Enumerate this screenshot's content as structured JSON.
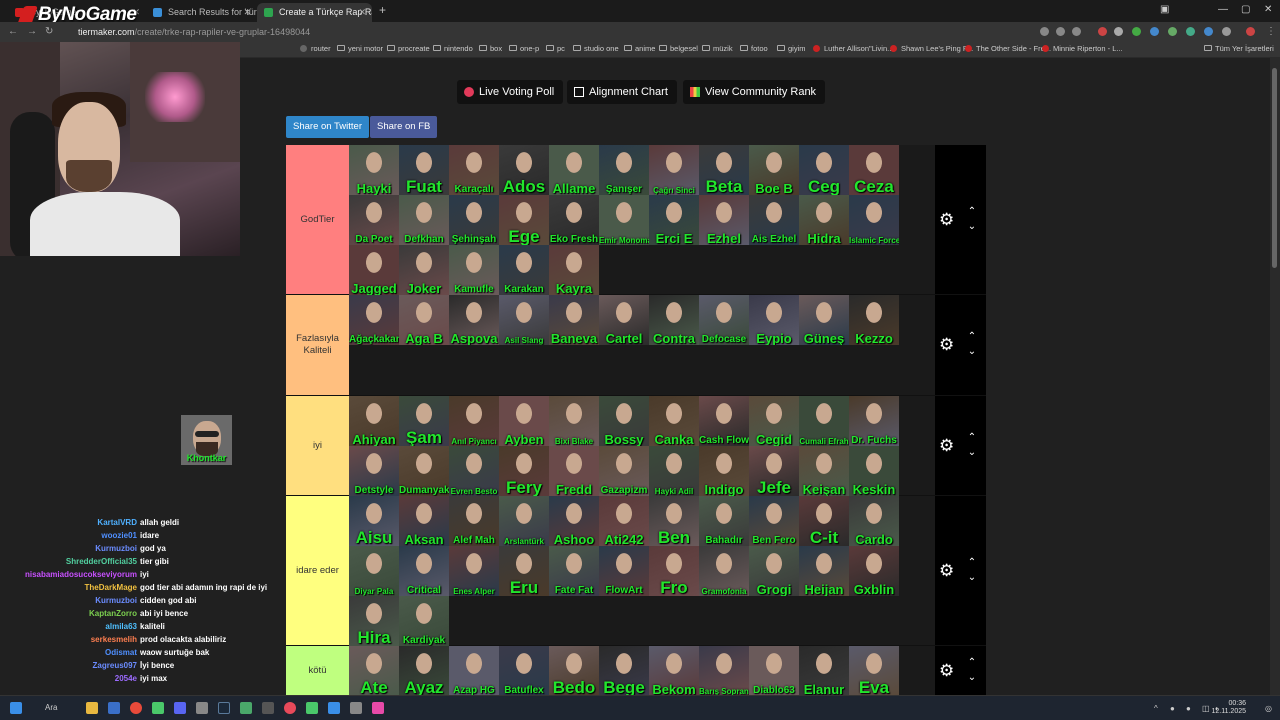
{
  "browser": {
    "tabs": [
      {
        "label": "ByNoGame",
        "active": false
      },
      {
        "label": "Search Results for 'türkçe rap'",
        "active": false
      },
      {
        "label": "Create a Türkçe Rap Rapçiler ve",
        "active": true
      }
    ],
    "url_host": "tiermaker.com",
    "url_path": "/create/trke-rap-rapiler-ve-gruplar-16498044",
    "bookmarks": [
      "router",
      "yeni motor",
      "procreate",
      "nintendo",
      "box",
      "one-p",
      "pc",
      "studio one",
      "anime",
      "belgesel",
      "müzik",
      "fotoo",
      "giyim",
      "Luther Allison\"Livin...",
      "Shawn Lee's Ping P...",
      "The Other Side - Fre...",
      "Minnie Riperton - L...",
      "Tüm Yer İşaretleri"
    ]
  },
  "overlay": {
    "logo": "ByNoGame",
    "small_cam_name": "Khontkar"
  },
  "toolbar": {
    "live_voting": "Live Voting Poll",
    "alignment_chart": "Alignment Chart",
    "community_rank": "View Community Rank",
    "share_twitter": "Share on Twitter",
    "share_fb": "Share on FB"
  },
  "tiers": [
    {
      "label": "GodTier",
      "color": "#ff7f7f",
      "items": [
        "Hayki",
        "Fuat",
        "Karaçalı",
        "Ados",
        "Allame",
        "Şanışer",
        "Çağrı Sinci",
        "Beta",
        "Boe B",
        "Ceg",
        "Ceza",
        "Da Poet",
        "Defkhan",
        "Şehinşah",
        "Ege",
        "Eko Fresh",
        "Emir Monoman",
        "Erci E",
        "Ezhel",
        "Ais Ezhel",
        "Hidra",
        "Islamic Force",
        "Jagged",
        "Joker",
        "Kamufle",
        "Karakan",
        "Kayra"
      ]
    },
    {
      "label": "Fazlasıyla Kaliteli",
      "color": "#ffbf7f",
      "items": [
        "Ağaçkakan",
        "Aga B",
        "Aspova",
        "Asil Slang",
        "Baneva",
        "Cartel",
        "Contra",
        "Defocase",
        "Eypio",
        "Güneş",
        "Kezzo"
      ]
    },
    {
      "label": "iyi",
      "color": "#ffdf7f",
      "items": [
        "Ahiyan",
        "Şam",
        "Anıl Piyancı",
        "Ayben",
        "Bixi Blake",
        "Bossy",
        "Canka",
        "Cash Flow",
        "Cegid",
        "Cumali Efrah",
        "Dr. Fuchs",
        "Detstyle",
        "Dumanyak",
        "Evren Besto",
        "Fery",
        "Fredd",
        "Gazapizm",
        "Hayki Adil",
        "Indigo",
        "Jefe",
        "Keişan",
        "Keskin"
      ]
    },
    {
      "label": "idare eder",
      "color": "#ffff7f",
      "items": [
        "Aisu",
        "Aksan",
        "Alef Mah",
        "Arslantürk",
        "Ashoo",
        "Ati242",
        "Ben",
        "Bahadır",
        "Ben Fero",
        "C-it",
        "Cardo",
        "Diyar Pala",
        "Critical",
        "Enes Alper",
        "Eru",
        "Fate Fat",
        "FlowArt",
        "Fro",
        "Gramofonia",
        "Grogi",
        "Heijan",
        "Gxblin",
        "Hira",
        "Kardiyak"
      ]
    },
    {
      "label": "kötü",
      "color": "#bfff7f",
      "items": [
        "Ate",
        "Ayaz",
        "Azap HG",
        "Batuflex",
        "Bedo",
        "Bege",
        "Bekom",
        "Barış Soprano",
        "Diablo63",
        "Elanur",
        "Eva"
      ]
    }
  ],
  "chat": [
    {
      "user": "KartalVRD",
      "msg": "allah geldi",
      "color": "#4fb0ff"
    },
    {
      "user": "woozie01",
      "msg": "idare",
      "color": "#4f8fff"
    },
    {
      "user": "Kurmuzboi",
      "msg": "god ya",
      "color": "#6b8cff"
    },
    {
      "user": "ShredderOfficial35",
      "msg": "tier gibi",
      "color": "#52d0a0"
    },
    {
      "user": "nisabamiadosucokseviyorum",
      "msg": "iyi",
      "color": "#c850ff"
    },
    {
      "user": "TheDarkMage",
      "msg": "god tier abi adamın ing rapi de iyi",
      "color": "#f0c040"
    },
    {
      "user": "Kurmuzboi",
      "msg": "cidden god abi",
      "color": "#6b8cff"
    },
    {
      "user": "KaptanZorro",
      "msg": "abi iyi bence",
      "color": "#7cd04f"
    },
    {
      "user": "almila63",
      "msg": "kaliteli",
      "color": "#4fc0ff"
    },
    {
      "user": "serkesmelih",
      "msg": "prod olacakta alabiliriz",
      "color": "#ff7f50"
    },
    {
      "user": "Odismat",
      "msg": "waow surtuğe bak",
      "color": "#4f8fff"
    },
    {
      "user": "Zagreus097",
      "msg": "İyi bence",
      "color": "#6b8cff"
    },
    {
      "user": "2054e",
      "msg": "iyi max",
      "color": "#9c6bff"
    }
  ],
  "taskbar": {
    "search": "Ara",
    "time": "00:36",
    "date": "12.11.2025"
  }
}
